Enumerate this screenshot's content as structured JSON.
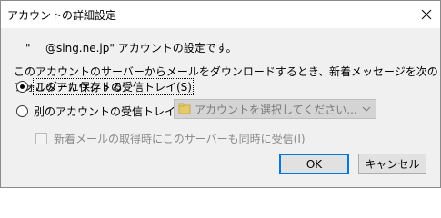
{
  "window": {
    "title": "アカウントの詳細設定"
  },
  "account": {
    "prefix": "\"",
    "text": "@sing.ne.jp\" アカウントの設定です。"
  },
  "instruction": "このアカウントのサーバーからメールをダウンロードするとき、新着メッセージを次のフォルダーに保存する:",
  "options": {
    "this_inbox": {
      "label": "このアカウントの受信トレイ(S)",
      "selected": true
    },
    "other_inbox": {
      "label": "別のアカウントの受信トレイ(D)",
      "selected": false
    }
  },
  "dropdown": {
    "placeholder": "アカウントを選択してください...",
    "enabled": false
  },
  "checkbox": {
    "label": "新着メールの取得時にこのサーバーも同時に受信(I)",
    "checked": false,
    "enabled": false
  },
  "buttons": {
    "ok": "OK",
    "cancel": "キャンセル"
  },
  "icons": {
    "close": "close-icon",
    "folder": "folder-icon",
    "chevron": "chevron-down-icon"
  },
  "colors": {
    "accent": "#0078d7",
    "folder": "#e8c96a"
  }
}
